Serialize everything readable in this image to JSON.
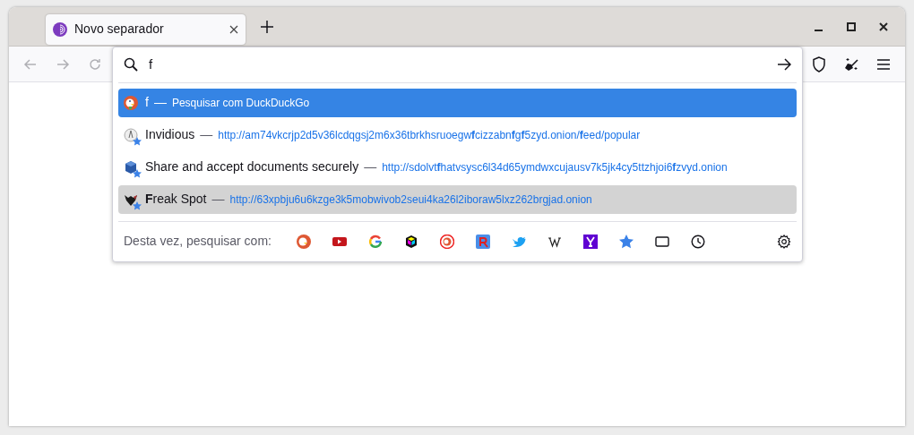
{
  "tabs": [
    {
      "label": "Novo separador",
      "selected": true
    }
  ],
  "urlbar": {
    "value": "f"
  },
  "results": [
    {
      "kind": "search",
      "title": "f",
      "separator": "—",
      "detail": "Pesquisar com DuckDuckGo",
      "selected": true,
      "hovered": false,
      "bookmarked": false
    },
    {
      "kind": "bookmark",
      "title": "Invidious",
      "separator": "—",
      "detail": "http://am74vkcrjp2d5v36lcdqgsj2m6x36tbrkhsruoegw**f**cizzabn**f**g**f**5zyd.onion/**f**eed/popular",
      "selected": false,
      "hovered": false,
      "bookmarked": true
    },
    {
      "kind": "bookmark",
      "title": "Share and accept documents securely",
      "separator": "—",
      "detail": "http://sdolvt**f**hatvsysc6l34d65ymdwxcujausv7k5jk4cy5ttzhjoi6**f**zvyd.onion",
      "selected": false,
      "hovered": false,
      "bookmarked": true
    },
    {
      "kind": "bookmark",
      "title": "**F**reak Spot",
      "separator": "—",
      "detail": "http://63xpbju6u6kzge3k5mobwivob2seui4ka26l2iboraw5lxz262brgjad.onion",
      "selected": false,
      "hovered": true,
      "bookmarked": true
    }
  ],
  "one_off": {
    "label": "Desta vez, pesquisar com:"
  }
}
